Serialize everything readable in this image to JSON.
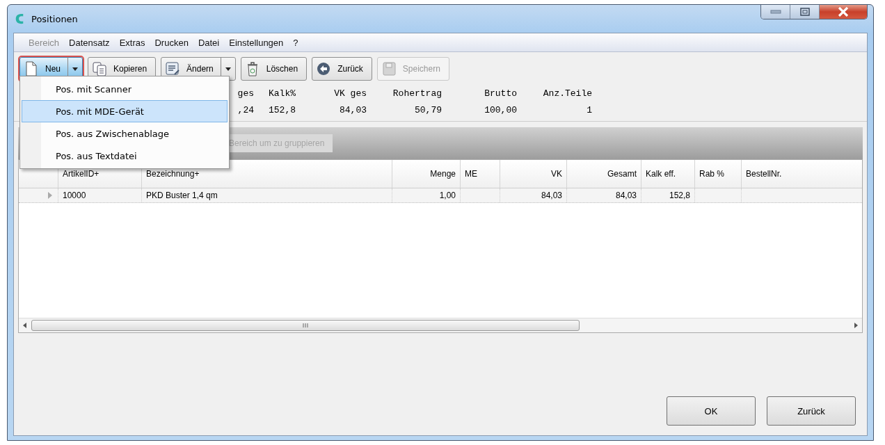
{
  "window": {
    "title": "Positionen"
  },
  "menu_bar": [
    {
      "label": "Bereich",
      "disabled": true
    },
    {
      "label": "Datensatz",
      "disabled": false
    },
    {
      "label": "Extras",
      "disabled": false
    },
    {
      "label": "Drucken",
      "disabled": false
    },
    {
      "label": "Datei",
      "disabled": false
    },
    {
      "label": "Einstellungen",
      "disabled": false
    },
    {
      "label": "?",
      "disabled": false
    }
  ],
  "toolbar": [
    {
      "label": "Neu",
      "split": true,
      "active": true,
      "disabled": false
    },
    {
      "label": "Kopieren",
      "split": false,
      "active": false,
      "disabled": false
    },
    {
      "label": "Ändern",
      "split": true,
      "active": false,
      "disabled": false
    },
    {
      "label": "Löschen",
      "split": false,
      "active": false,
      "disabled": false
    },
    {
      "label": "Zurück",
      "split": false,
      "active": false,
      "disabled": false
    },
    {
      "label": "Speichern",
      "split": false,
      "active": false,
      "disabled": true
    }
  ],
  "dropdown": [
    {
      "label": "Pos. mit Scanner",
      "selected": false
    },
    {
      "label": "Pos. mit MDE-Gerät",
      "selected": true
    },
    {
      "label": "Pos. aus Zwischenablage",
      "selected": false
    },
    {
      "label": "Pos. aus Textdatei",
      "selected": false
    }
  ],
  "summary": [
    {
      "label": "ges",
      "value": ",24"
    },
    {
      "label": "Kalk%",
      "value": "152,8"
    },
    {
      "label": "VK ges",
      "value": "84,03"
    },
    {
      "label": "Rohertrag",
      "value": "50,79"
    },
    {
      "label": "Brutto",
      "value": "100,00"
    },
    {
      "label": "Anz.Teile",
      "value": "1"
    }
  ],
  "group_panel": {
    "hint": "Bereich um zu gruppieren"
  },
  "table": {
    "columns": [
      "ArtikelID+",
      "Bezeichnung+",
      "Menge",
      "ME",
      "VK",
      "Gesamt",
      "Kalk eff.",
      "Rab %",
      "BestellNr."
    ],
    "rows": [
      {
        "selected": true,
        "cells": [
          "10000",
          "PKD Buster 1,4 qm",
          "1,00",
          "",
          "84,03",
          "84,03",
          "152,8",
          "",
          ""
        ]
      }
    ]
  },
  "buttons": [
    "OK",
    "Zurück"
  ]
}
